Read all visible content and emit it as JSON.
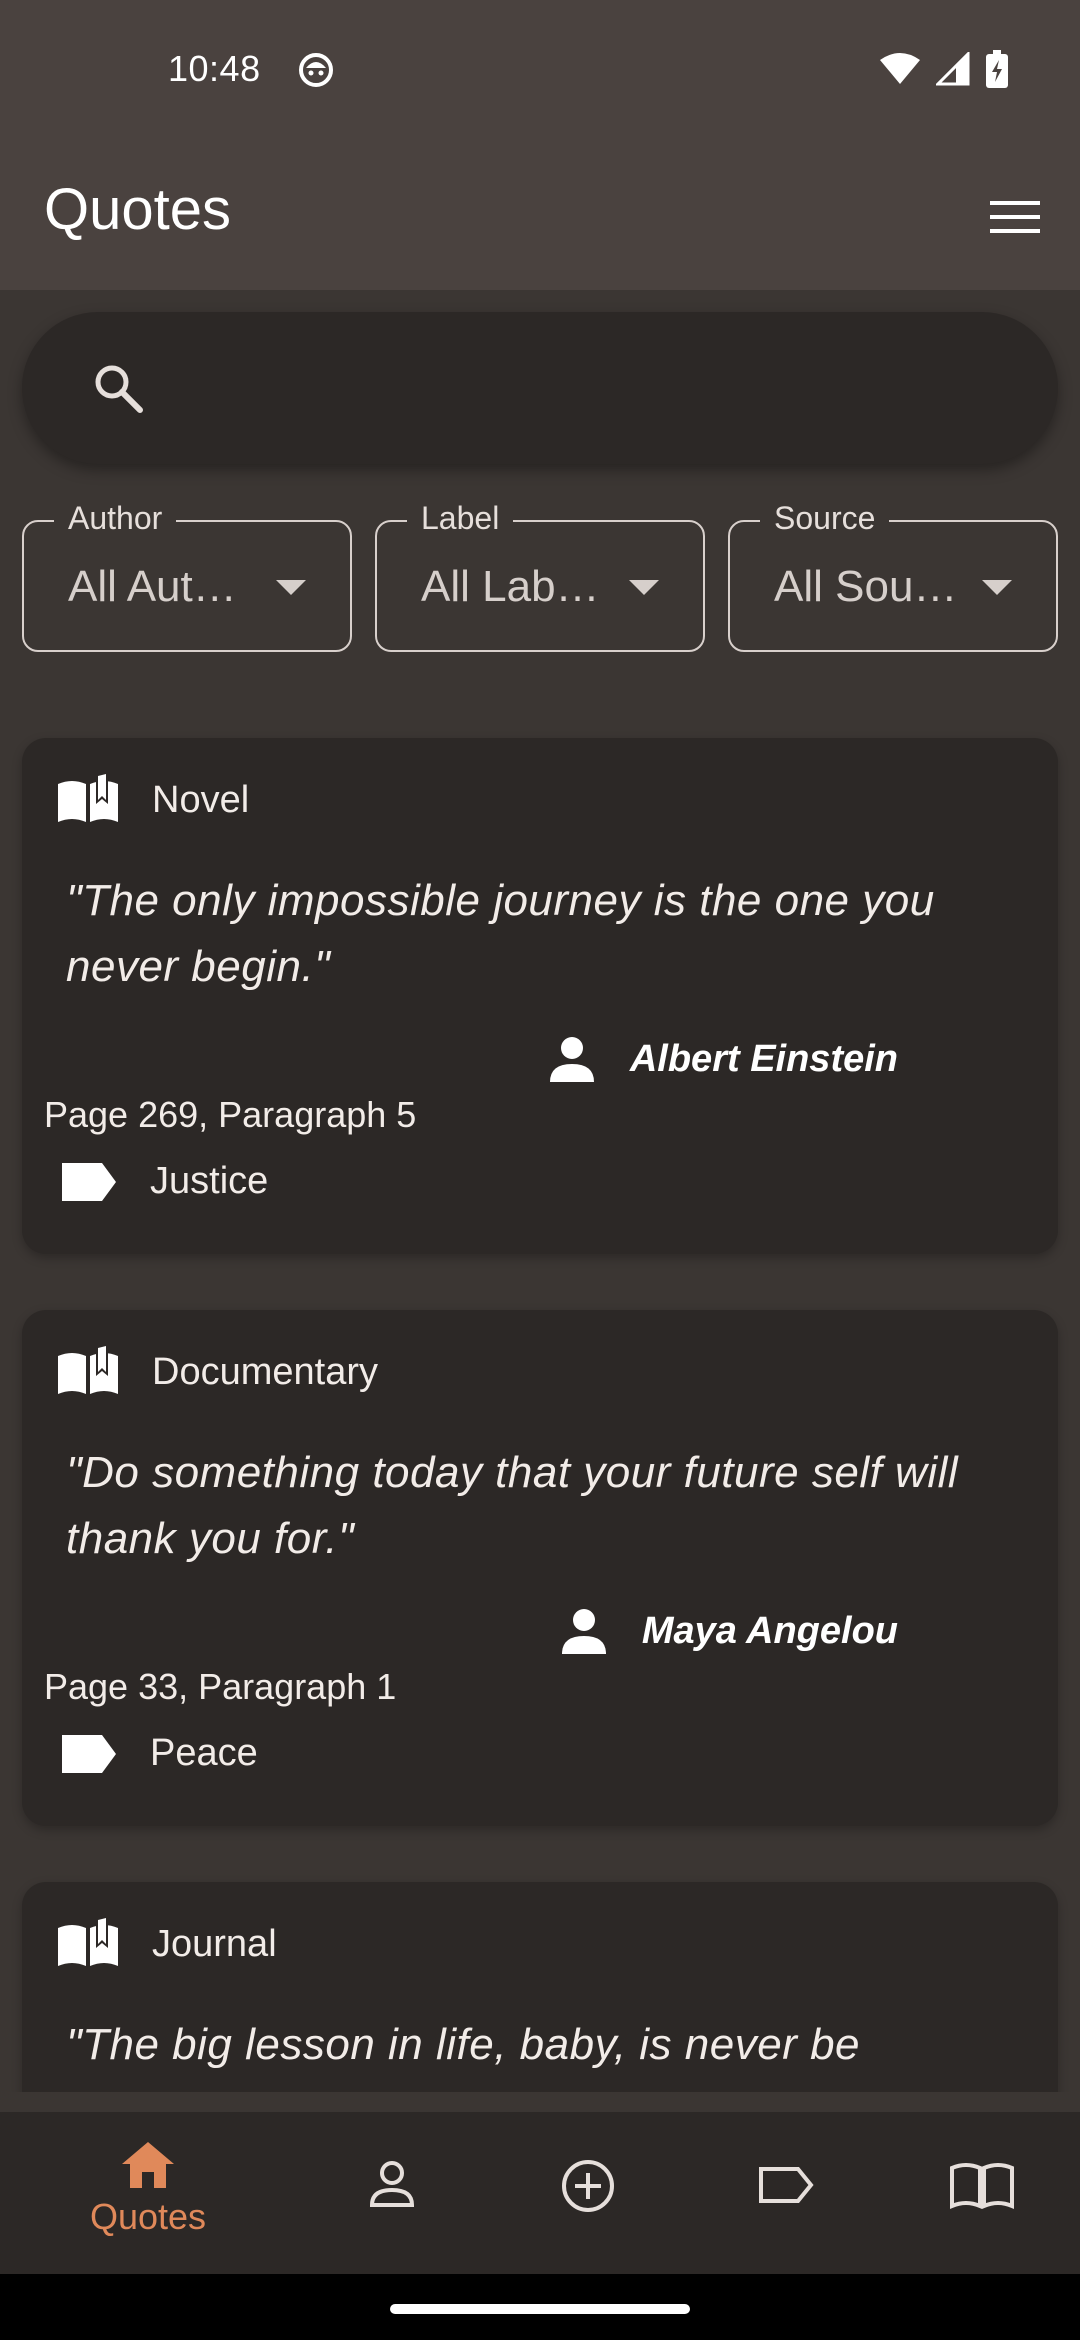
{
  "status_bar": {
    "time": "10:48"
  },
  "app_bar": {
    "title": "Quotes"
  },
  "search": {
    "placeholder": ""
  },
  "filters": [
    {
      "label": "Author",
      "value": "All Aut…"
    },
    {
      "label": "Label",
      "value": "All Lab…"
    },
    {
      "label": "Source",
      "value": "All Sou…"
    }
  ],
  "quotes": [
    {
      "source_type": "Novel",
      "text": "\"The only impossible journey is the one you never begin.\"",
      "author": "Albert Einstein",
      "location": "Page 269, Paragraph 5",
      "tag": "Justice"
    },
    {
      "source_type": "Documentary",
      "text": "\"Do something today that your future self will thank you for.\"",
      "author": "Maya Angelou",
      "location": "Page 33, Paragraph 1",
      "tag": "Peace"
    },
    {
      "source_type": "Journal",
      "text": "\"The big lesson in life, baby, is never be",
      "author": "",
      "location": "",
      "tag": ""
    }
  ],
  "bottom_nav": {
    "items": [
      {
        "label": "Quotes",
        "icon": "home-icon",
        "active": true
      },
      {
        "label": "",
        "icon": "person-icon",
        "active": false
      },
      {
        "label": "",
        "icon": "add-circle-icon",
        "active": false
      },
      {
        "label": "",
        "icon": "label-icon",
        "active": false
      },
      {
        "label": "",
        "icon": "book-icon",
        "active": false
      }
    ]
  },
  "colors": {
    "background": "#3b3633",
    "surface": "#2c2826",
    "app_bar": "#4a423f",
    "accent": "#e0895a",
    "text": "#f2ece8"
  }
}
